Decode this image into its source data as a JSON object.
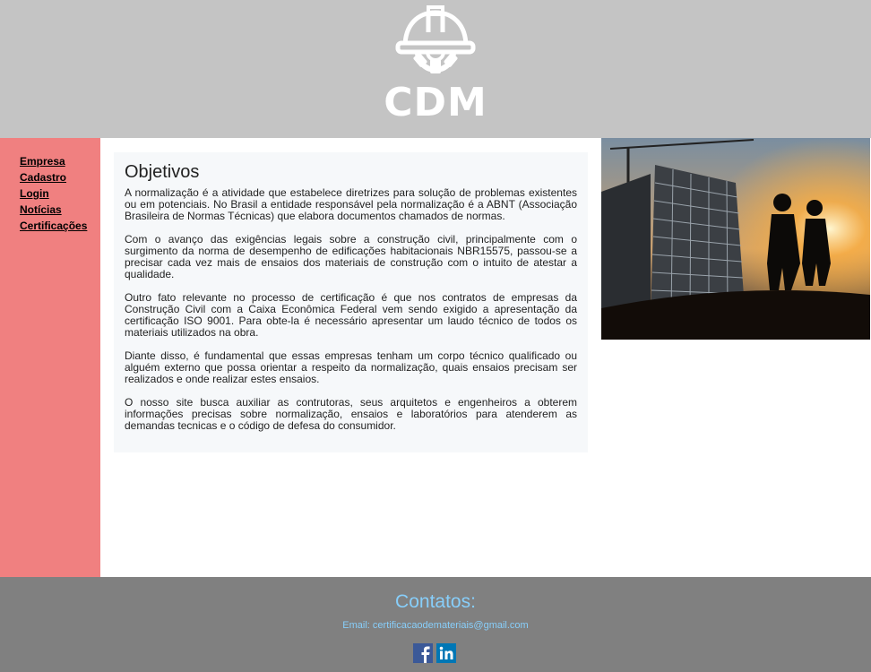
{
  "header": {
    "logo_text": "CDM",
    "logo_icon": "hardhat-gear-icon"
  },
  "nav": {
    "items": [
      {
        "label": "Empresa"
      },
      {
        "label": "Cadastro"
      },
      {
        "label": "Login"
      },
      {
        "label": "Notícias"
      },
      {
        "label": "Certificações"
      }
    ]
  },
  "article": {
    "title": "Objetivos",
    "paragraphs": [
      "A normalização é a atividade que estabelece diretrizes para solução de problemas existentes ou em potenciais. No Brasil a entidade responsável pela normalização é a ABNT (Associação Brasileira de Normas Técnicas) que elabora documentos chamados de normas.",
      "Com o avanço das exigências legais sobre a construção civil, principalmente com o surgimento da norma de desempenho de edificações habitacionais NBR15575, passou-se a precisar cada vez mais de ensaios dos materiais de construção com o intuito de atestar a qualidade.",
      "Outro fato relevante no processo de certificação é que nos contratos de empresas da Construção Civil com a Caixa Econômica Federal vem sendo exigido a apresentação da certificação ISO 9001. Para obte-la é necessário apresentar um laudo técnico de todos os materiais utilizados na obra.",
      "Diante disso, é fundamental que essas empresas tenham um corpo técnico qualificado ou alguém externo que possa orientar a respeito da normalização, quais ensaios precisam ser realizados e onde realizar estes ensaios.",
      "O nosso site busca auxiliar as contrutoras, seus arquitetos e engenheiros a obterem informações precisas sobre normalização, ensaios e laboratórios para atenderem as demandas tecnicas e o código de defesa do consumidor."
    ]
  },
  "footer": {
    "title": "Contatos:",
    "email": "Email: certificacaodemateriais@gmail.com",
    "social": [
      {
        "icon": "facebook-icon",
        "color": "#3b5998"
      },
      {
        "icon": "linkedin-icon",
        "color": "#0077b5"
      }
    ]
  },
  "colors": {
    "header_bg": "#c4c4c4",
    "sidebar_bg": "#f08080",
    "footer_bg": "#808080",
    "footer_text": "#87cefa",
    "article_bg": "#f6f8fa"
  }
}
